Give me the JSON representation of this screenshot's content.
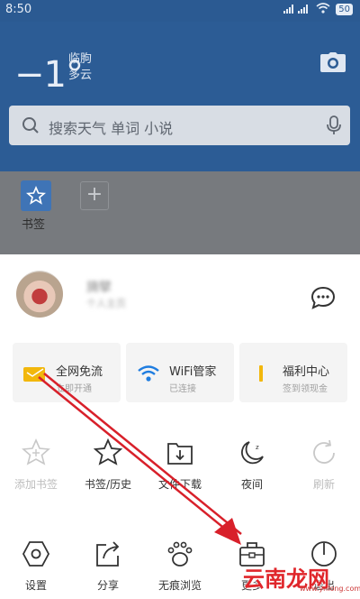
{
  "status_bar": {
    "time": "8:50",
    "battery": "50"
  },
  "weather": {
    "temperature": "−1°",
    "city": "临朐",
    "condition": "多云"
  },
  "search": {
    "placeholder": "搜索天气 单词 小说"
  },
  "quick_links": {
    "bookmark_label": "书签",
    "add_symbol": "+"
  },
  "profile": {
    "name": "旖擘",
    "subtitle": "个人主页"
  },
  "cards": [
    {
      "title": "全网免流",
      "subtitle": "立即开通",
      "icon": "sim-card-icon",
      "color": "#f2b70c"
    },
    {
      "title": "WiFi管家",
      "subtitle": "已连接",
      "icon": "wifi-icon",
      "color": "#1f7de0"
    },
    {
      "title": "福利中心",
      "subtitle": "签到领现金",
      "icon": "gift-icon",
      "color": "#f2b70c"
    }
  ],
  "menu_row1": [
    {
      "label": "添加书签",
      "icon": "star-add-icon",
      "enabled": false
    },
    {
      "label": "书签/历史",
      "icon": "star-icon",
      "enabled": true
    },
    {
      "label": "文件下载",
      "icon": "download-folder-icon",
      "enabled": true
    },
    {
      "label": "夜间",
      "icon": "moon-icon",
      "enabled": true
    },
    {
      "label": "刷新",
      "icon": "refresh-icon",
      "enabled": false
    }
  ],
  "menu_row2": [
    {
      "label": "设置",
      "icon": "settings-hexagon-icon",
      "enabled": true
    },
    {
      "label": "分享",
      "icon": "share-icon",
      "enabled": true
    },
    {
      "label": "无痕浏览",
      "icon": "paw-icon",
      "enabled": true
    },
    {
      "label": "更多",
      "icon": "toolbox-icon",
      "enabled": true
    },
    {
      "label": "退出",
      "icon": "power-icon",
      "enabled": true
    }
  ],
  "watermark": {
    "text": "云南龙网",
    "url": "www.ynlong.com"
  },
  "colors": {
    "header_blue": "#2c5c95",
    "accent_yellow": "#f2b70c",
    "accent_blue": "#1f7de0",
    "annotation_red": "#d8202a"
  }
}
